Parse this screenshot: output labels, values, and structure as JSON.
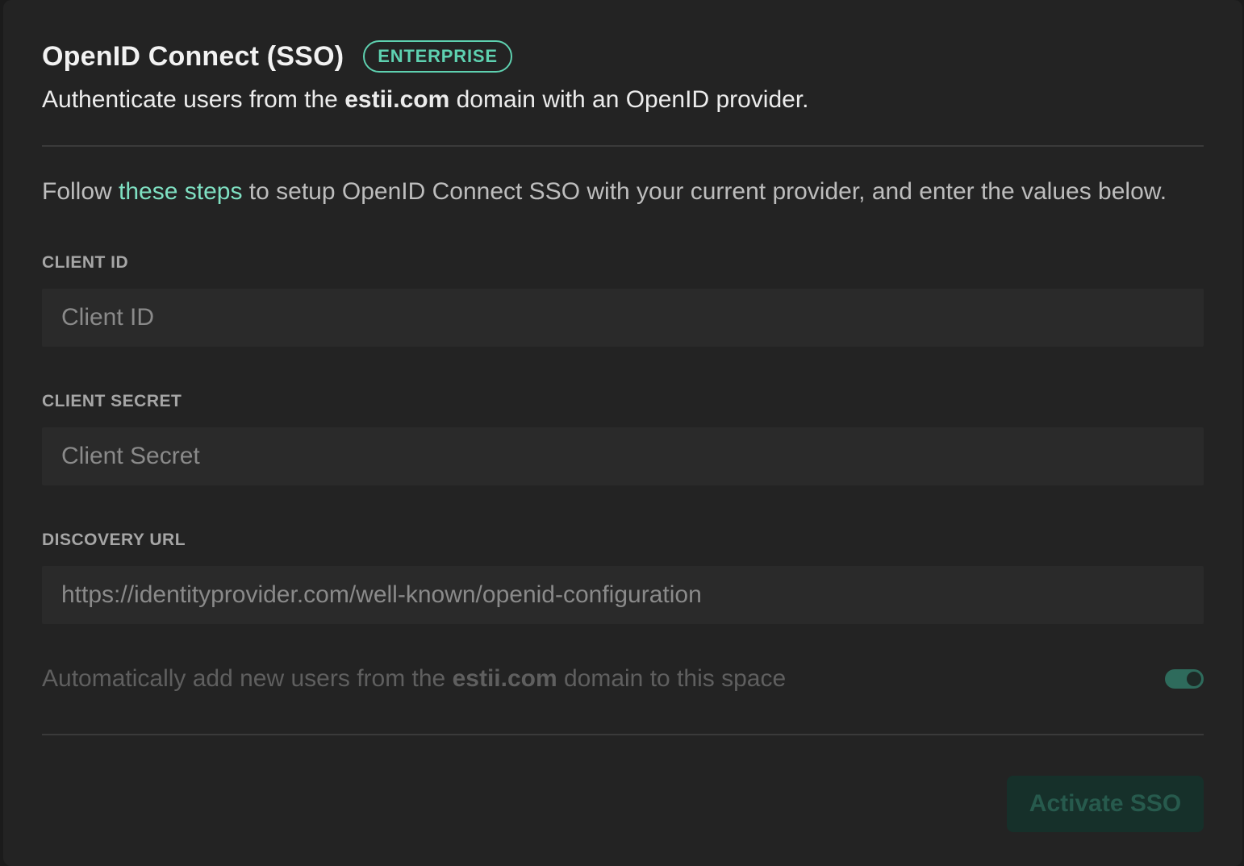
{
  "header": {
    "title": "OpenID Connect (SSO)",
    "badge": "ENTERPRISE"
  },
  "subtitle": {
    "prefix": "Authenticate users from the ",
    "domain": "estii.com",
    "suffix": " domain with an OpenID provider."
  },
  "instructions": {
    "prefix": "Follow ",
    "link_text": "these steps",
    "suffix": " to setup OpenID Connect SSO with your current provider, and enter the values below."
  },
  "fields": {
    "client_id": {
      "label": "CLIENT ID",
      "placeholder": "Client ID",
      "value": ""
    },
    "client_secret": {
      "label": "CLIENT SECRET",
      "placeholder": "Client Secret",
      "value": ""
    },
    "discovery_url": {
      "label": "DISCOVERY URL",
      "placeholder": "https://identityprovider.com/well-known/openid-configuration",
      "value": ""
    }
  },
  "auto_add": {
    "prefix": "Automatically add new users from the ",
    "domain": "estii.com",
    "suffix": " domain to this space",
    "enabled": true
  },
  "footer": {
    "activate_label": "Activate SSO"
  },
  "colors": {
    "accent": "#5ed1b0",
    "link": "#7fe0c2",
    "panel_bg": "#232323",
    "input_bg": "#2a2a2a",
    "button_bg": "#16302a"
  }
}
